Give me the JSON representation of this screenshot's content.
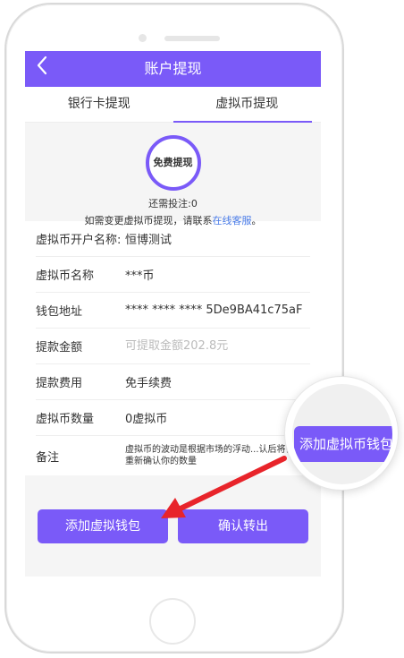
{
  "header": {
    "back_icon": "chevron-left-icon",
    "title": "账户提现"
  },
  "tabs": [
    {
      "label": "银行卡提现",
      "active": false
    },
    {
      "label": "虚拟币提现",
      "active": true
    }
  ],
  "summary": {
    "badge": "免费提现",
    "remaining": "还需投注:0",
    "contact_text": "如需变更虚拟币提现，请联系",
    "contact_link": "在线客服",
    "contact_suffix": "。"
  },
  "form": {
    "account_name": {
      "label": "虚拟币开户名称:",
      "value": "恒博测试"
    },
    "coin_name": {
      "label": "虚拟币名称",
      "value": "***币"
    },
    "wallet": {
      "label": "钱包地址",
      "value": "**** **** **** 5De9BA41c75aF"
    },
    "amount": {
      "label": "提款金额",
      "placeholder": "可提取金额202.8元"
    },
    "fee": {
      "label": "提款费用",
      "value": "免手续费"
    },
    "coin_count": {
      "label": "虚拟币数量",
      "value": "0虚拟币"
    },
    "remark": {
      "label": "备注",
      "value": "虚拟币的波动是根据市场的浮动...认后将会重新确认你的数量"
    }
  },
  "buttons": {
    "add_wallet": "添加虚拟钱包",
    "confirm": "确认转出"
  },
  "callout": {
    "label": "添加虚拟币钱包"
  },
  "colors": {
    "accent": "#7a5af8",
    "link": "#4a7ce8",
    "arrow": "#e8242a"
  }
}
